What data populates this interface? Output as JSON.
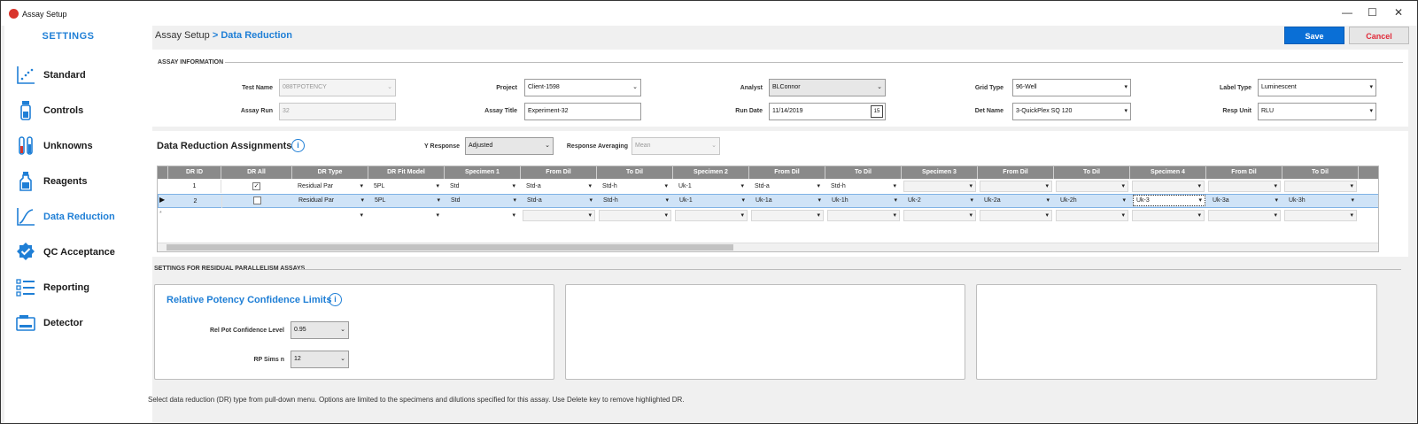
{
  "window": {
    "title": "Assay Setup",
    "controls": {
      "minimize": "—",
      "maximize": "☐",
      "close": "✕"
    }
  },
  "sidebar": {
    "title": "SETTINGS",
    "items": [
      {
        "label": "Standard",
        "icon": "scatter-chart-icon"
      },
      {
        "label": "Controls",
        "icon": "vial-icon"
      },
      {
        "label": "Unknowns",
        "icon": "test-tubes-icon"
      },
      {
        "label": "Reagents",
        "icon": "bottle-icon"
      },
      {
        "label": "Data Reduction",
        "icon": "curve-chart-icon",
        "active": true
      },
      {
        "label": "QC Acceptance",
        "icon": "check-badge-icon"
      },
      {
        "label": "Reporting",
        "icon": "checklist-icon"
      },
      {
        "label": "Detector",
        "icon": "detector-icon"
      }
    ]
  },
  "breadcrumb": {
    "parent": "Assay Setup",
    "separator": " > ",
    "current": "Data Reduction"
  },
  "toolbar": {
    "save_label": "Save",
    "cancel_label": "Cancel"
  },
  "assay_info": {
    "heading": "ASSAY INFORMATION",
    "test_name": {
      "label": "Test Name",
      "value": "088TPOTENCY"
    },
    "assay_run": {
      "label": "Assay Run",
      "value": "32"
    },
    "project": {
      "label": "Project",
      "value": "Client-1598"
    },
    "assay_title": {
      "label": "Assay Title",
      "value": "Experiment-32"
    },
    "analyst": {
      "label": "Analyst",
      "value": "BLConnor"
    },
    "run_date": {
      "label": "Run Date",
      "value": "11/14/2019",
      "cal": "15"
    },
    "grid_type": {
      "label": "Grid Type",
      "value": "96-Well"
    },
    "det_name": {
      "label": "Det Name",
      "value": "3-QuickPlex SQ 120"
    },
    "label_type": {
      "label": "Label Type",
      "value": "Luminescent"
    },
    "resp_unit": {
      "label": "Resp Unit",
      "value": "RLU"
    }
  },
  "dr": {
    "title": "Data Reduction Assignments",
    "info": "i",
    "y_response": {
      "label": "Y Response",
      "value": "Adjusted"
    },
    "response_averaging": {
      "label": "Response Averaging",
      "value": "Mean"
    },
    "columns": [
      "DR ID",
      "DR All",
      "DR Type",
      "DR Fit Model",
      "Specimen 1",
      "From Dil",
      "To Dil",
      "Specimen 2",
      "From Dil",
      "To Dil",
      "Specimen 3",
      "From Dil",
      "To Dil",
      "Specimen 4",
      "From Dil",
      "To Dil"
    ],
    "rows": [
      {
        "id": "1",
        "all": "✓",
        "type": "Residual Par",
        "fit": "5PL",
        "s1": "Std",
        "s1f": "Std-a",
        "s1t": "Std-h",
        "s2": "Uk-1",
        "s2f": "Std-a",
        "s2t": "Std-h",
        "s3": "",
        "s3f": "",
        "s3t": "",
        "s4": "",
        "s4f": "",
        "s4t": ""
      },
      {
        "id": "2",
        "all": "",
        "type": "Residual Par",
        "fit": "5PL",
        "s1": "Std",
        "s1f": "Std-a",
        "s1t": "Std-h",
        "s2": "Uk-1",
        "s2f": "Uk-1a",
        "s2t": "Uk-1h",
        "s3": "Uk-2",
        "s3f": "Uk-2a",
        "s3t": "Uk-2h",
        "s4": "Uk-3",
        "s4f": "Uk-3a",
        "s4t": "Uk-3h"
      }
    ],
    "current_row_marker": "▶",
    "new_row_marker": "*"
  },
  "residual": {
    "heading": "SETTINGS FOR RESIDUAL PARALLELISM ASSAYS",
    "rp_title": "Relative Potency Confidence Limits",
    "info": "i",
    "confidence_level": {
      "label": "Rel Pot Confidence Level",
      "value": "0.95"
    },
    "sims_n": {
      "label": "RP Sims n",
      "value": "12"
    }
  },
  "footer_text": "Select data reduction (DR) type from pull-down menu.  Options are limited to the specimens and dilutions specified for this assay. Use Delete key to remove highlighted DR.",
  "colors": {
    "accent": "#1f7fd6",
    "save": "#0a6fd6",
    "cancel_text": "#e02b3a",
    "grid_header": "#8a8a8a",
    "selected_row": "#cfe3f7"
  }
}
